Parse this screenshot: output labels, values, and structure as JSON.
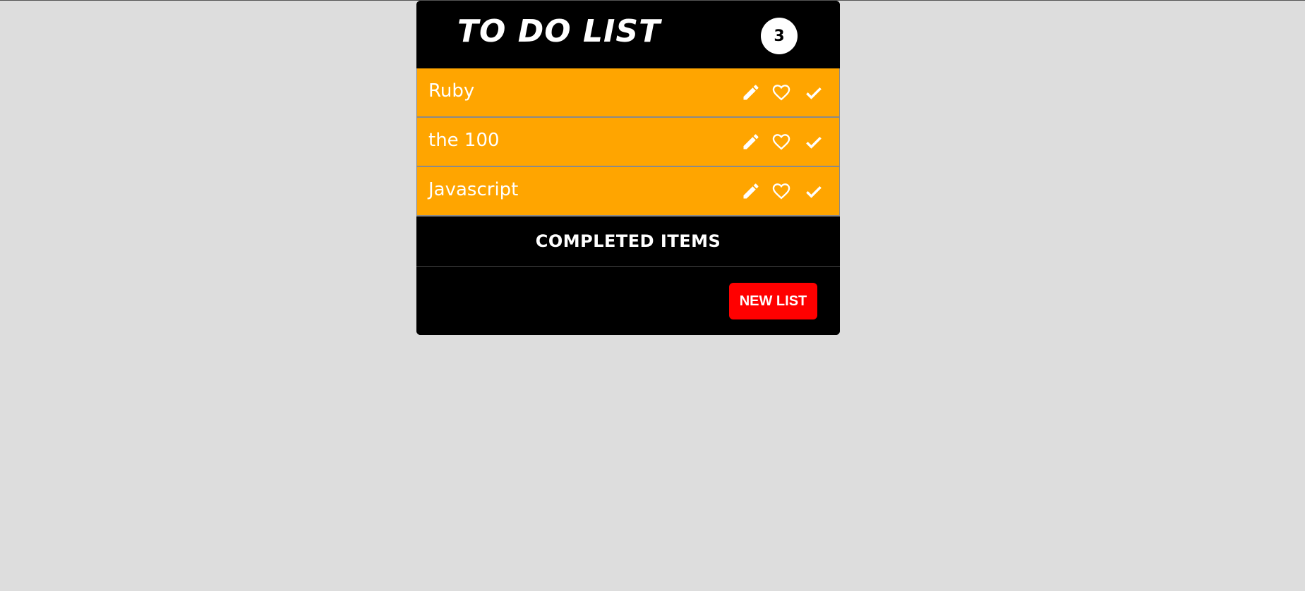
{
  "header": {
    "title": "TO DO LIST",
    "count": "3"
  },
  "items": [
    {
      "label": "Ruby",
      "icons": [
        "pencil-icon",
        "heart-outline-icon",
        "check-icon"
      ]
    },
    {
      "label": "the 100",
      "icons": [
        "pencil-icon",
        "heart-outline-icon",
        "check-icon"
      ]
    },
    {
      "label": "Javascript",
      "icons": [
        "pencil-icon",
        "heart-outline-icon",
        "check-icon"
      ]
    }
  ],
  "completed": {
    "label": "COMPLETED ITEMS"
  },
  "footer": {
    "new_list_label": "NEW LIST"
  },
  "colors": {
    "background": "#dddddd",
    "card": "#000000",
    "item": "#ffa500",
    "button": "#ff0000",
    "text": "#ffffff"
  }
}
